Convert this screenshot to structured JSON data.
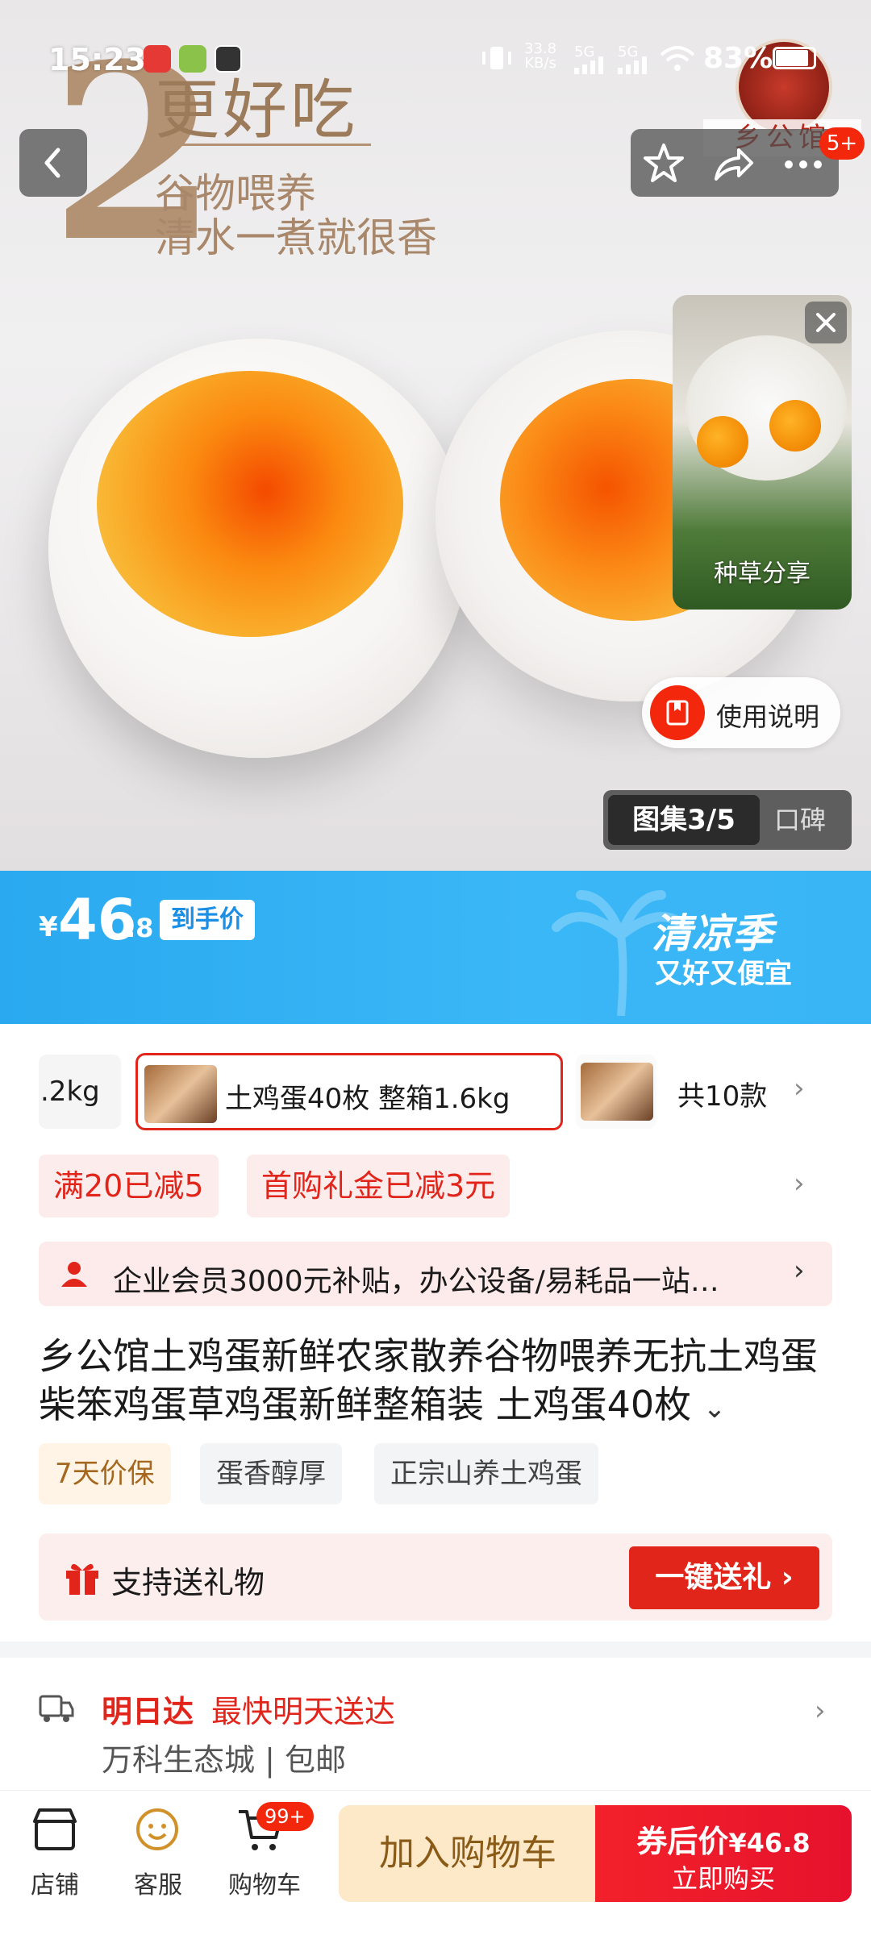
{
  "status_bar": {
    "time": "15:23",
    "net_speed_value": "33.8",
    "net_speed_unit": "KB/s",
    "sim1": "5G",
    "sim2": "5G",
    "battery": "83%"
  },
  "hero": {
    "big_number": "2",
    "title": "更好吃",
    "line1": "谷物喂养",
    "line2": "清水一煮就很香",
    "brand_logo_text": "乡公馆"
  },
  "top_actions": {
    "badge": "5+"
  },
  "share_card": {
    "label": "种草分享"
  },
  "usage_button": {
    "label": "使用说明"
  },
  "gallery": {
    "active": "图集3/5",
    "other": "口碑"
  },
  "price": {
    "currency": "¥",
    "integer": "46",
    "decimal": ".8",
    "tag": "到手价",
    "season_title": "清凉季",
    "season_sub": "又好又便宜"
  },
  "variants": {
    "prev_partial": ".2kg",
    "selected": "土鸡蛋40枚 整箱1.6kg",
    "total": "共10款"
  },
  "promos": [
    {
      "label": "满20已减5"
    },
    {
      "label": "首购礼金已减3元"
    }
  ],
  "member": {
    "text": "企业会员3000元补贴，办公设备/易耗品一站…"
  },
  "product": {
    "title": "乡公馆土鸡蛋新鲜农家散养谷物喂养无抗土鸡蛋柴笨鸡蛋草鸡蛋新鲜整箱装 土鸡蛋40枚"
  },
  "tags": [
    {
      "label": "7天价保"
    },
    {
      "label": "蛋香醇厚"
    },
    {
      "label": "正宗山养土鸡蛋"
    }
  ],
  "gift": {
    "label": "支持送礼物",
    "button": "一键送礼"
  },
  "delivery": {
    "speed": "明日达",
    "desc": "最快明天送达",
    "address": "万科生态城 | 包邮"
  },
  "bottom_nav": {
    "store": "店铺",
    "service": "客服",
    "cart": "购物车",
    "cart_badge": "99+",
    "add_to_cart": "加入购物车",
    "buy_line1_label": "券后价",
    "buy_line1_price": "¥46.8",
    "buy_line2": "立即购买"
  },
  "colors": {
    "accent_red": "#e1251b",
    "price_blue": "#2aa9f0",
    "cart_btn_bg": "#fde8c8"
  }
}
